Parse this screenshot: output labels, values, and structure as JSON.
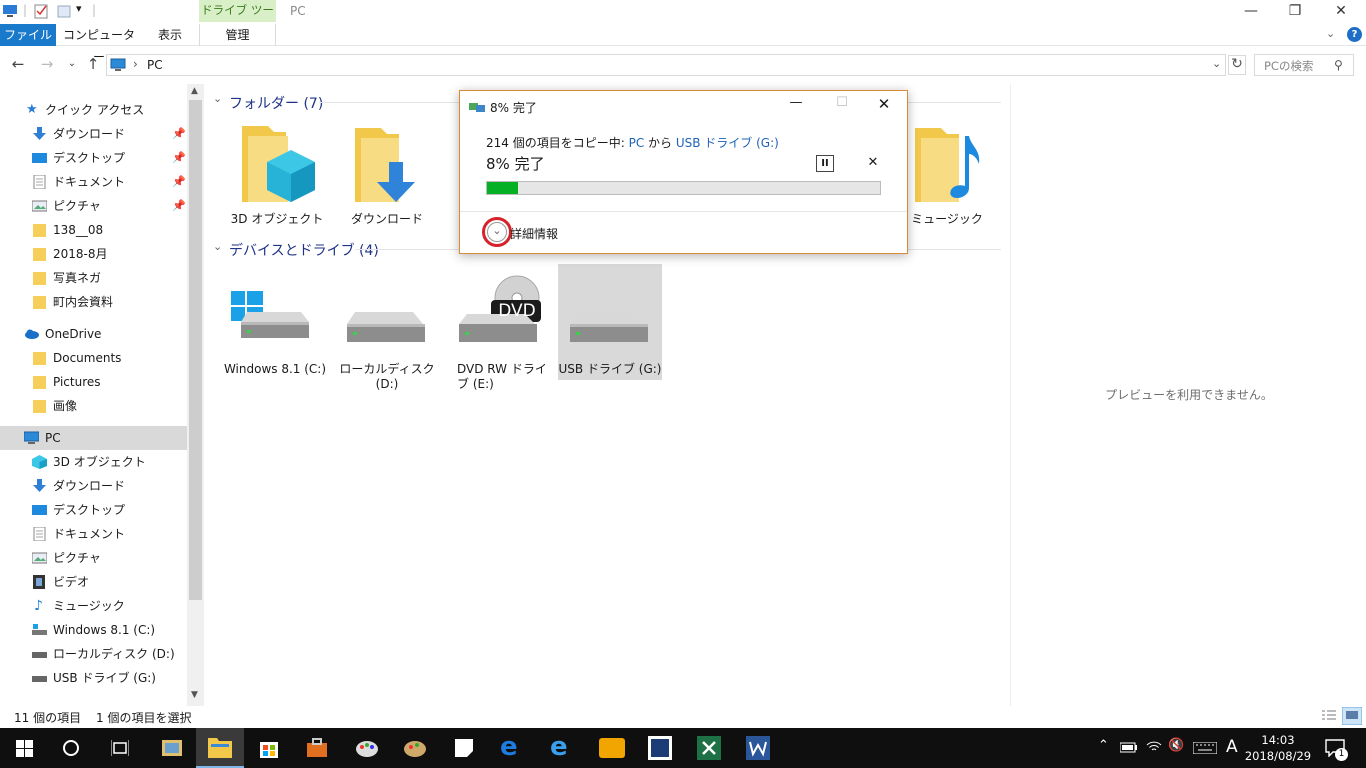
{
  "titlebar": {
    "tools_tab": "ドライブ ツール",
    "title": "PC",
    "minimize": "—",
    "restore": "❐",
    "close": "✕"
  },
  "ribbon": {
    "tabs": [
      "ファイル",
      "コンピューター",
      "表示",
      "管理"
    ],
    "help": "?"
  },
  "address": {
    "path_sep": "›",
    "path": "PC",
    "search_placeholder": "PCの検索"
  },
  "nav": {
    "quick_access": "クイック アクセス",
    "quick_items": [
      "ダウンロード",
      "デスクトップ",
      "ドキュメント",
      "ピクチャ",
      "138__08",
      "2018-8月",
      "写真ネガ",
      "町内会資料"
    ],
    "onedrive": "OneDrive",
    "onedrive_items": [
      "Documents",
      "Pictures",
      "画像"
    ],
    "pc": "PC",
    "pc_items": [
      "3D オブジェクト",
      "ダウンロード",
      "デスクトップ",
      "ドキュメント",
      "ピクチャ",
      "ビデオ",
      "ミュージック",
      "Windows 8.1 (C:)",
      "ローカルディスク (D:)",
      "USB ドライブ (G:)"
    ]
  },
  "content": {
    "folders_header": "フォルダー (7)",
    "folders": [
      "3D オブジェクト",
      "ダウンロード",
      "ミュージック"
    ],
    "devices_header": "デバイスとドライブ (4)",
    "drives": [
      "Windows 8.1 (C:)",
      "ローカルディスク (D:)",
      "DVD RW ドライブ (E:)",
      "USB ドライブ (G:)"
    ],
    "dvd_badge": "DVD"
  },
  "preview": {
    "message": "プレビューを利用できません。"
  },
  "status": {
    "count": "11 個の項目",
    "selected": "1 個の項目を選択"
  },
  "dialog": {
    "title": "8% 完了",
    "msg_prefix": "214 個の項目をコピー中: ",
    "source": "PC",
    "msg_mid": " から ",
    "dest": "USB ドライブ (G:)",
    "percent_text": "8% 完了",
    "progress": 0.08,
    "details_label": "詳細情報",
    "pause": "II",
    "cancel": "✕"
  },
  "taskbar": {
    "time": "14:03",
    "date": "2018/08/29",
    "ime": "A",
    "notif_count": "1"
  },
  "colors": {
    "accent": "#0078d7",
    "progress": "#06b025",
    "highlight_circle": "#d6222a",
    "folder": "#f2c84b"
  }
}
